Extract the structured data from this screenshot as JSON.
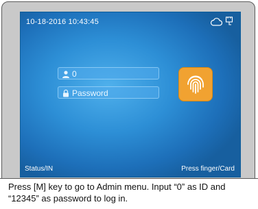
{
  "status_bar": {
    "datetime": "10-18-2016 10:43:45",
    "cloud_icon": "cloud-icon",
    "network_icon": "network-plug-icon"
  },
  "login": {
    "id_value": "0",
    "id_icon": "user-icon",
    "password_placeholder": "Password",
    "password_icon": "lock-icon",
    "fingerprint_icon": "fingerprint-icon",
    "fingerprint_button_color": "#f1a231"
  },
  "footer": {
    "status": "Status/IN",
    "prompt": "Press finger/Card"
  },
  "caption": {
    "text": "Press [M] key to go to Admin menu. Input “0” as ID and “12345” as password to log in."
  },
  "colors": {
    "screen_blue": "#2d8fd6",
    "accent_orange": "#f1a231"
  }
}
